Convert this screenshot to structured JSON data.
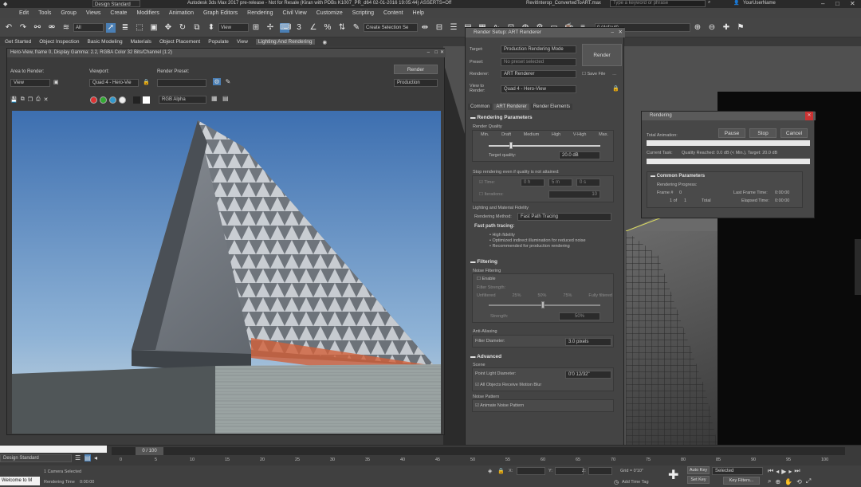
{
  "title_bar": {
    "workspace": "Design Standard",
    "app_title": "Autodesk 3ds Max 2017 pre-release - Not for Resale (Kiran with PDBs K1007_PR_d64 02-01-2016 19:05:44) ASSERTS=Off",
    "file_name": "RevitInterop_ConvertedToART.max",
    "search_placeholder": "Type a keyword or phrase",
    "user_name": "YourUserName"
  },
  "menu": [
    "Edit",
    "Tools",
    "Group",
    "Views",
    "Create",
    "Modifiers",
    "Animation",
    "Graph Editors",
    "Rendering",
    "Civil View",
    "Customize",
    "Scripting",
    "Content",
    "Help"
  ],
  "toolbar": {
    "selection_filter": "All",
    "view_combo": "View",
    "selection_set": "Create Selection Se",
    "layer": "0 (default)"
  },
  "ribbon_tabs": [
    "Get Started",
    "Object Inspection",
    "Basic Modeling",
    "Materials",
    "Object Placement",
    "Populate",
    "View",
    "Lighting And Rendering"
  ],
  "frame_buffer": {
    "title": "Hero-View, frame 0, Display Gamma: 2.2, RGBA Color 32 Bits/Channel (1:2)",
    "area_label": "Area to Render:",
    "area_value": "View",
    "viewport_label": "Viewport:",
    "viewport_value": "Quad 4 - Hero-Vie",
    "preset_label": "Render Preset:",
    "preset_value": "",
    "render_button": "Render",
    "production_value": "Production",
    "channel_value": "RGB Alpha"
  },
  "render_setup": {
    "title": "Render Setup: ART Renderer",
    "target_label": "Target:",
    "target_value": "Production Rendering Mode",
    "preset_label": "Preset:",
    "preset_value": "No preset selected",
    "renderer_label": "Renderer:",
    "renderer_value": "ART Renderer",
    "save_file": "Save File",
    "view_label": "View to Render:",
    "view_value": "Quad 4 - Hero-View",
    "render_button": "Render",
    "tabs": [
      "Common",
      "ART Renderer",
      "Render Elements"
    ],
    "rendering_parameters": "Rendering Parameters",
    "render_quality": "Render Quality",
    "quality_levels": [
      "Min.",
      "Draft",
      "Medium",
      "High",
      "V-High",
      "Max."
    ],
    "target_quality_label": "Target quality:",
    "target_quality_value": "20.0 dB",
    "stop_label": "Stop rendering even if quality is not attained:",
    "time_label": "Time:",
    "time_h": "0 h",
    "time_m": "5 m",
    "time_s": "0 s",
    "iterations_label": "Iterations:",
    "iterations_value": "10",
    "lighting_fidelity": "Lighting and Material Fidelity",
    "rendering_method_label": "Rendering Method:",
    "rendering_method_value": "Fast Path Tracing",
    "fast_path_title": "Fast path tracing:",
    "fast_path_notes": [
      "• High fidelity",
      "• Optimized indirect illumination for reduced noise",
      "• Recommended for production rendering"
    ],
    "filtering": "Filtering",
    "noise_filtering": "Noise Filtering",
    "enable": "Enable",
    "filter_strength": "Filter Strength:",
    "strength_levels": [
      "Unfiltered",
      "25%",
      "50%",
      "75%",
      "Fully filtered"
    ],
    "strength_label": "Strength:",
    "strength_value": "50%",
    "anti_aliasing": "Anti-Aliasing",
    "filter_diameter_label": "Filter Diameter:",
    "filter_diameter_value": "3.0 pixels",
    "advanced": "Advanced",
    "scene": "Scene",
    "point_light_label": "Point Light Diameter:",
    "point_light_value": "0'0 12/32\"",
    "motion_blur": "All Objects Receive Motion Blur",
    "noise_pattern": "Noise Pattern",
    "animate_noise": "Animate Noise Pattern",
    "quality_fraction": 0.2
  },
  "rendering_dialog": {
    "title": "Rendering",
    "pause": "Pause",
    "stop": "Stop",
    "cancel": "Cancel",
    "total_animation": "Total Animation:",
    "current_task": "Current Task:",
    "current_task_value": "Quality Reached: 0.0 dB (< Min.), Target: 20.0 dB",
    "common_parameters": "Common Parameters",
    "rendering_progress": "Rendering Progress:",
    "frame_label": "Frame #",
    "frame_value": "0",
    "of_label": "1 of",
    "of_value": "1",
    "total_label": "Total",
    "last_frame_time": "Last Frame Time:",
    "last_frame_value": "0:00:00",
    "elapsed_time": "Elapsed Time:",
    "elapsed_value": "0:00:00"
  },
  "timeline": {
    "frame_counter": "0 / 100",
    "ticks": [
      "0",
      "5",
      "10",
      "15",
      "20",
      "25",
      "30",
      "35",
      "40",
      "45",
      "50",
      "55",
      "60",
      "65",
      "70",
      "75",
      "80",
      "85",
      "90",
      "95",
      "100"
    ]
  },
  "status": {
    "workspace": "Design Standard",
    "selection": "1 Camera Selected",
    "rendering_time_label": "Rendering Time",
    "rendering_time_value": "0:00:00",
    "welcome": "Welcome to M",
    "x_label": "X:",
    "y_label": "Y:",
    "z_label": "Z:",
    "grid": "Grid = 0'10\"",
    "add_time_tag": "Add Time Tag",
    "auto_key": "Auto Key",
    "set_key": "Set Key",
    "selected": "Selected",
    "key_filters": "Key Filters..."
  }
}
